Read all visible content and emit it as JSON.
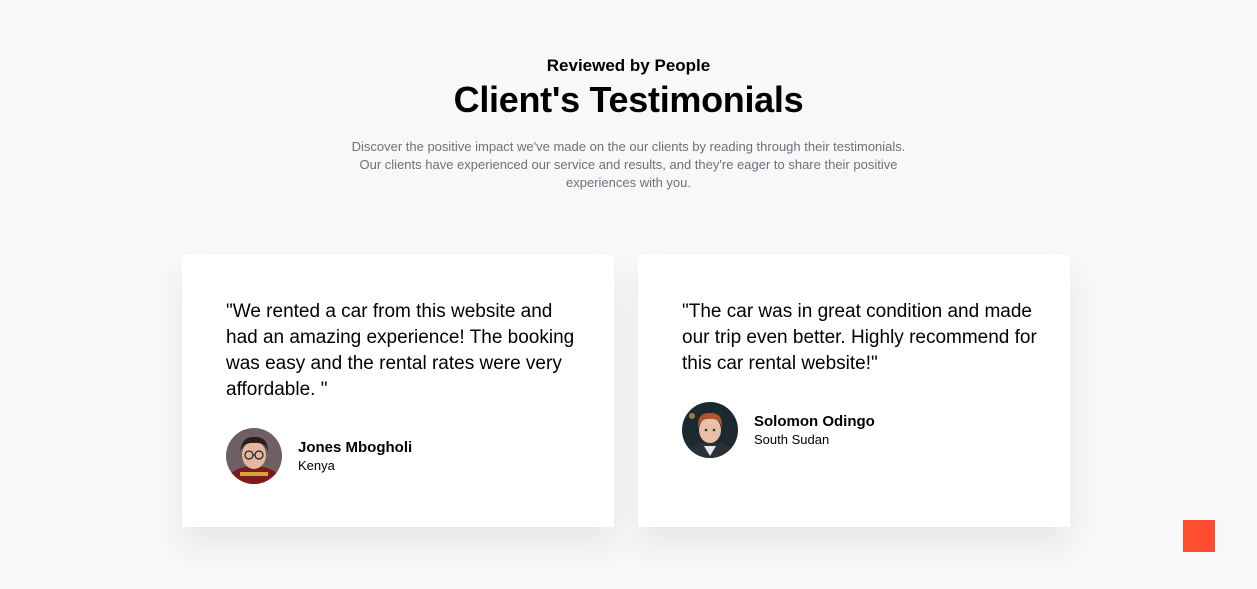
{
  "heading": {
    "eyebrow": "Reviewed by People",
    "title": "Client's Testimonials",
    "description": "Discover the positive impact we've made on the our clients by reading through their testimonials. Our clients have experienced our service and results, and they're eager to share their positive experiences with you."
  },
  "testimonials": [
    {
      "quote": "\"We rented a car from this website and had an amazing experience! The booking was easy and the rental rates were very affordable. \"",
      "name": "Jones Mbogholi",
      "location": "Kenya",
      "avatar_icon": "user-photo"
    },
    {
      "quote": "\"The car was in great condition and made our trip even better. Highly recommend for this car rental website!\"",
      "name": "Solomon Odingo",
      "location": "South Sudan",
      "avatar_icon": "user-photo"
    }
  ],
  "colors": {
    "accent": "#ff4d30",
    "background": "#f8f8f8",
    "card": "#ffffff",
    "text": "#010103",
    "muted": "#706f7b"
  },
  "scroll_top": {
    "icon": "scroll-to-top-icon"
  }
}
